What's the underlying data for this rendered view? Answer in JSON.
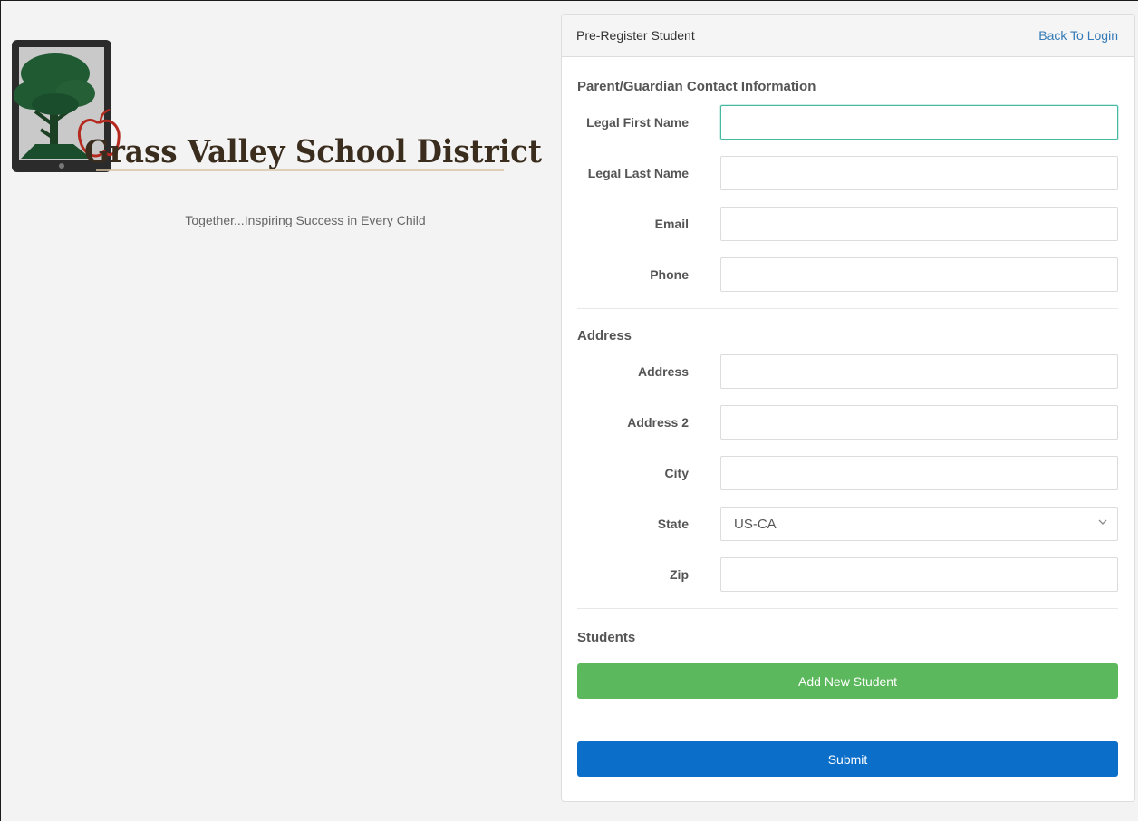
{
  "brand": {
    "name": "Grass Valley School District",
    "tagline": "Together...Inspiring Success in Every Child"
  },
  "panel": {
    "title": "Pre-Register Student",
    "back_link": "Back To Login"
  },
  "contact": {
    "heading": "Parent/Guardian Contact Information",
    "fields": [
      {
        "label": "Legal First Name",
        "value": ""
      },
      {
        "label": "Legal Last Name",
        "value": ""
      },
      {
        "label": "Email",
        "value": ""
      },
      {
        "label": "Phone",
        "value": ""
      }
    ]
  },
  "address": {
    "heading": "Address",
    "fields": [
      {
        "label": "Address",
        "value": ""
      },
      {
        "label": "Address 2",
        "value": ""
      },
      {
        "label": "City",
        "value": ""
      },
      {
        "label": "State",
        "value": "US-CA"
      },
      {
        "label": "Zip",
        "value": ""
      }
    ]
  },
  "students": {
    "heading": "Students",
    "add_button": "Add New Student"
  },
  "submit_button": "Submit",
  "colors": {
    "accent_blue": "#0b6ec8",
    "success_green": "#5cb85c",
    "link_blue": "#337ab7",
    "focus_teal": "#45b8a0",
    "logo_text": "#3a2d1e",
    "tree_green": "#1f5a32"
  },
  "icons": {
    "logo": "tablet-tree-apple-logo",
    "select": "chevron-down-icon"
  }
}
